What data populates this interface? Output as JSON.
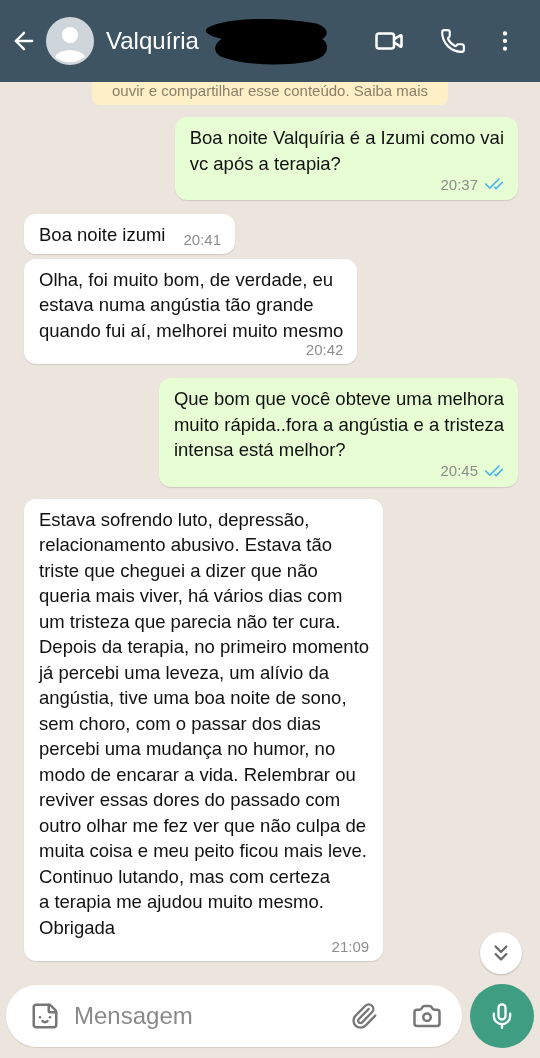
{
  "header": {
    "contact_name": "Valquíria",
    "name_redacted": true
  },
  "notice": "ouvir e compartilhar esse conteúdo. Saiba mais",
  "messages": [
    {
      "outgoing": true,
      "text": "Boa noite Valquíria é a Izumi como vai\nvc após a terapia?",
      "time": "20:37",
      "read": true
    },
    {
      "outgoing": false,
      "text": "Boa noite izumi",
      "time": "20:41",
      "inline": true
    },
    {
      "outgoing": false,
      "text": "Olha, foi muito bom, de verdade, eu\nestava numa angústia tão grande\nquando fui aí, melhorei muito mesmo",
      "time": "20:42"
    },
    {
      "outgoing": true,
      "text": "Que bom que você obteve uma melhora\nmuito rápida..fora a angústia e a tristeza\nintensa está melhor?",
      "time": "20:45",
      "read": true
    },
    {
      "outgoing": false,
      "text": "Estava sofrendo luto, depressão,\nrelacionamento abusivo. Estava tão\ntriste que cheguei a dizer que não\nqueria mais viver, há vários dias com\num tristeza que parecia não ter cura.\nDepois da terapia, no primeiro momento\njá percebi uma leveza, um alívio da\nangústia, tive uma boa noite de sono,\nsem choro, com o passar dos dias\npercebi uma mudança no humor, no\nmodo de encarar a vida. Relembrar ou\nreviver essas dores do passado com\noutro olhar me fez ver que não culpa de\nmuita coisa e meu peito ficou mais leve.\nContinuo lutando, mas com certeza\na terapia me ajudou muito mesmo.\nObrigada",
      "time": "21:09"
    }
  ],
  "composer": {
    "placeholder": "Mensagem"
  }
}
